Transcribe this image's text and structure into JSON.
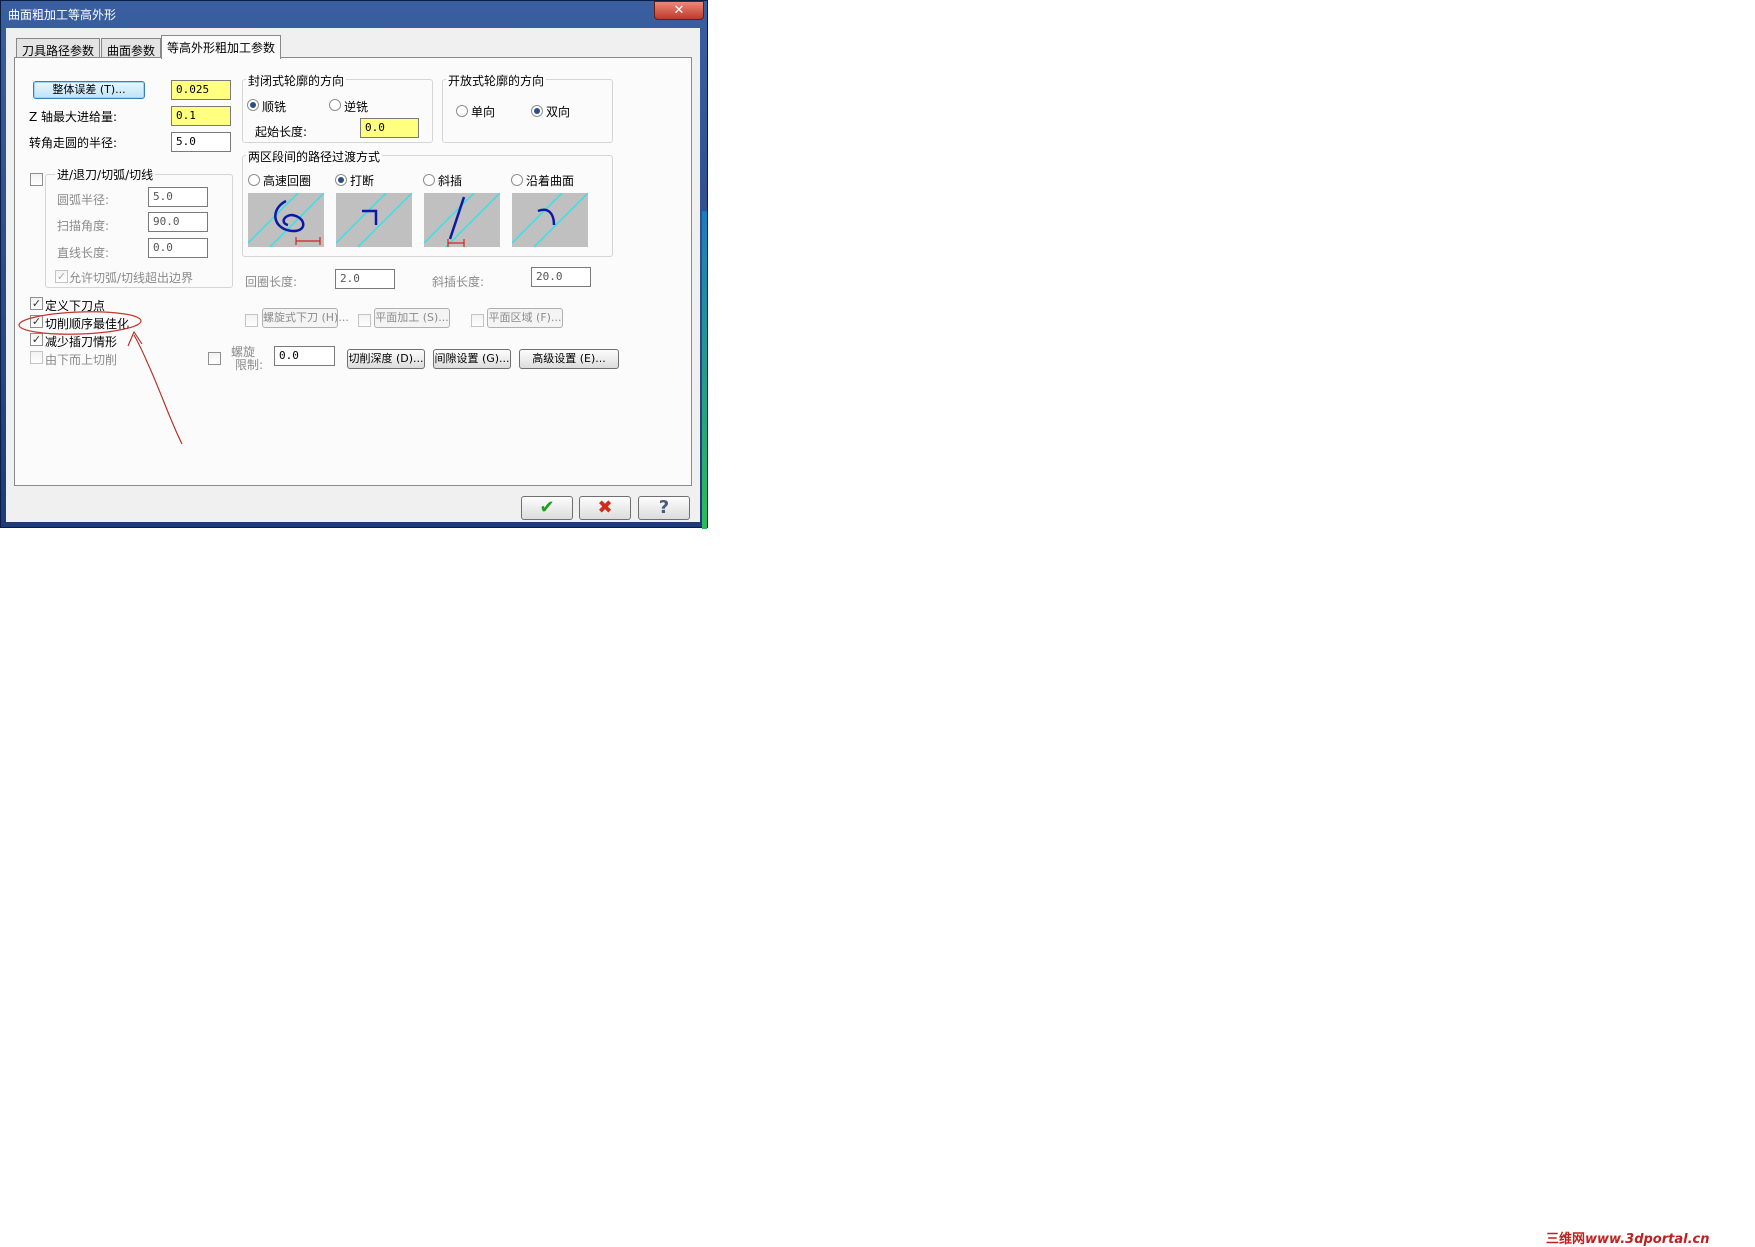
{
  "window": {
    "title": "曲面粗加工等高外形",
    "close_glyph": "✕"
  },
  "tabs": [
    {
      "label": "刀具路径参数"
    },
    {
      "label": "曲面参数"
    },
    {
      "label": "等高外形粗加工参数"
    }
  ],
  "left": {
    "tolerance_button": "整体误差 (T)...",
    "tolerance_value": "0.025",
    "z_step_label": "Z 轴最大进给量:",
    "z_step_value": "0.1",
    "corner_radius_label": "转角走圆的半径:",
    "corner_radius_value": "5.0",
    "entry_group_label": "进/退刀/切弧/切线",
    "arc_radius_label": "圆弧半径:",
    "arc_radius_value": "5.0",
    "sweep_angle_label": "扫描角度:",
    "sweep_angle_value": "90.0",
    "line_length_label": "直线长度:",
    "line_length_value": "0.0",
    "allow_exceed_label": "允许切弧/切线超出边界"
  },
  "closed_contour": {
    "title": "封闭式轮廓的方向",
    "climb": "顺铣",
    "conventional": "逆铣",
    "start_length_label": "起始长度:",
    "start_length_value": "0.0"
  },
  "open_contour": {
    "title": "开放式轮廓的方向",
    "one_way": "单向",
    "two_way": "双向"
  },
  "transition": {
    "title": "两区段间的路径过渡方式",
    "options": [
      "高速回圈",
      "打断",
      "斜插",
      "沿着曲面"
    ],
    "loop_length_label": "回圈长度:",
    "loop_length_value": "2.0",
    "ramp_length_label": "斜插长度:",
    "ramp_length_value": "20.0"
  },
  "options": {
    "define_plunge": "定义下刀点",
    "optimize_order": "切削顺序最佳化",
    "reduce_plunge": "减少插刀情形",
    "bottom_up": "由下而上切削"
  },
  "row_buttons": {
    "helix_plunge": "螺旋式下刀 (H)...",
    "flat_machining": "平面加工 (S)...",
    "flat_area": "平面区域 (F)...",
    "spiral_label_1": "螺旋",
    "spiral_label_2": "限制:",
    "spiral_value": "0.0",
    "cut_depth": "切削深度 (D)...",
    "gap_settings": "间隙设置 (G)...",
    "advanced": "高级设置 (E)..."
  },
  "bottom": {
    "ok_glyph": "✔",
    "cancel_glyph": "✖",
    "help_glyph": "?"
  },
  "watermark": {
    "brand": "三维网",
    "url": "www.3dportal.cn"
  },
  "colors": {
    "accent_yellow": "#ffff80",
    "annotation_red": "#c0392b",
    "preview_cyan": "#36e0e8",
    "preview_path": "#0a1aa8"
  }
}
